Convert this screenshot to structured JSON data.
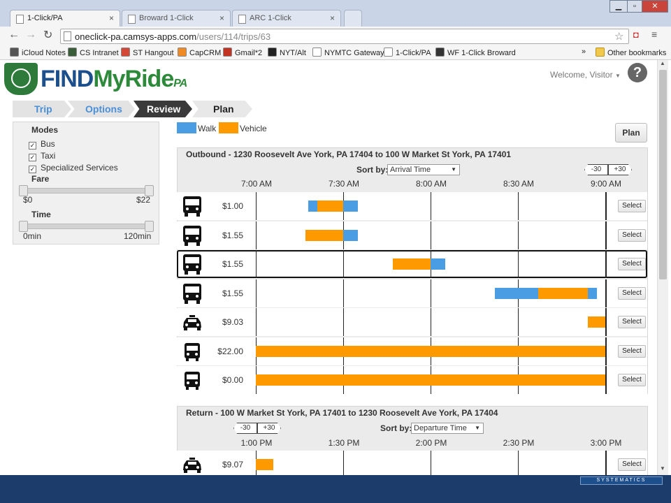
{
  "browser": {
    "tabs": [
      {
        "title": "1-Click/PA",
        "active": true
      },
      {
        "title": "Broward 1-Click",
        "active": false
      },
      {
        "title": "ARC 1-Click",
        "active": false
      }
    ],
    "url_host": "oneclick-pa.camsys-apps.com",
    "url_path": "/users/114/trips/63",
    "bookmarks": [
      {
        "label": "iCloud Notes",
        "icon": "apple-icon",
        "color": "#555555"
      },
      {
        "label": "CS Intranet",
        "icon": "cs-icon",
        "color": "#3a5d3a"
      },
      {
        "label": "ST Hangout",
        "icon": "google-plus-icon",
        "color": "#d34836"
      },
      {
        "label": "CapCRM",
        "icon": "capcrm-icon",
        "color": "#f08a24"
      },
      {
        "label": "Gmail*2",
        "icon": "gmail-icon",
        "color": "#c23321"
      },
      {
        "label": "NYT/Alt",
        "icon": "nyt-icon",
        "color": "#222222"
      },
      {
        "label": "NYMTC Gateway",
        "icon": "page-icon",
        "color": "#ffffff"
      },
      {
        "label": "1-Click/PA",
        "icon": "page-icon",
        "color": "#ffffff"
      },
      {
        "label": "WF 1-Click Broward",
        "icon": "wf-icon",
        "color": "#333333"
      }
    ],
    "more_bookmarks": "»",
    "other_bookmarks": "Other bookmarks"
  },
  "header": {
    "logo_find": "FIND",
    "logo_myride": "MyRide",
    "logo_pa": "PA",
    "welcome": "Welcome, Visitor",
    "help": "?"
  },
  "steps": [
    "Trip",
    "Options",
    "Review",
    "Plan"
  ],
  "filters": {
    "modes_title": "Modes",
    "modes": [
      "Bus",
      "Taxi",
      "Specialized Services"
    ],
    "fare_title": "Fare",
    "fare_min": "$0",
    "fare_max": "$22",
    "time_title": "Time",
    "time_min": "0min",
    "time_max": "120min"
  },
  "legend": {
    "walk": "Walk",
    "vehicle": "Vehicle",
    "walk_color": "#4a9de3",
    "vehicle_color": "#ff9900"
  },
  "plan_button": "Plan",
  "outbound": {
    "title": "Outbound - 1230 Roosevelt Ave York, PA 17404 to 100 W Market St York, PA 17401",
    "sort_label": "Sort by:",
    "sort_value": "Arrival Time",
    "minus": "-30",
    "plus": "+30",
    "times": [
      "7:00 AM",
      "7:30 AM",
      "8:00 AM",
      "8:30 AM",
      "9:00 AM"
    ],
    "itineraries": [
      {
        "mode": "bus",
        "price": "$1.00",
        "selected": false
      },
      {
        "mode": "bus",
        "price": "$1.55",
        "selected": false
      },
      {
        "mode": "bus",
        "price": "$1.55",
        "selected": true
      },
      {
        "mode": "bus",
        "price": "$1.55",
        "selected": false
      },
      {
        "mode": "taxi",
        "price": "$9.03",
        "selected": false
      },
      {
        "mode": "van",
        "price": "$22.00",
        "selected": false
      },
      {
        "mode": "van",
        "price": "$0.00",
        "selected": false
      }
    ],
    "select_label": "Select"
  },
  "return": {
    "title": "Return - 100 W Market St York, PA 17401 to 1230 Roosevelt Ave York, PA 17404",
    "sort_label": "Sort by:",
    "sort_value": "Departure Time",
    "minus": "-30",
    "plus": "+30",
    "times": [
      "1:00 PM",
      "1:30 PM",
      "2:00 PM",
      "2:30 PM",
      "3:00 PM"
    ],
    "itineraries": [
      {
        "mode": "taxi",
        "price": "$9.07"
      }
    ],
    "select_label": "Select"
  },
  "footer_brand": "SYSTEMATICS"
}
